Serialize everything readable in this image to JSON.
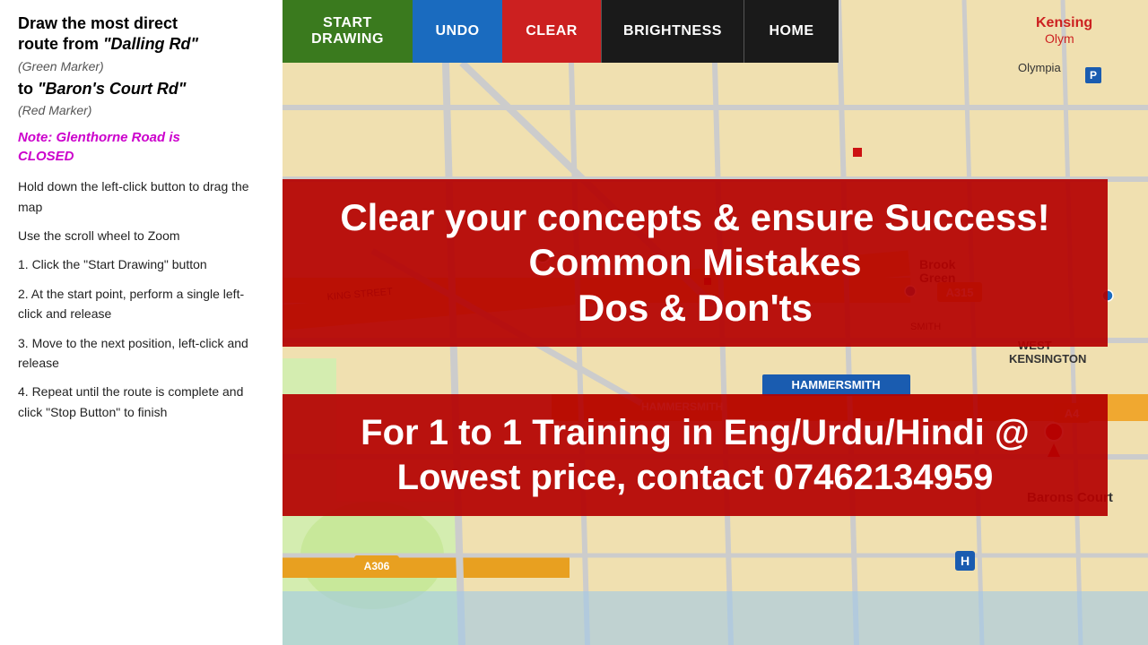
{
  "left_panel": {
    "title_line1": "Draw the most direct",
    "title_line2": "route from ",
    "from_location": "\"Dalling Rd\"",
    "from_marker": "(Green Marker)",
    "to_label": "to ",
    "to_location": "\"Baron's Court Rd\"",
    "to_marker": "(Red Marker)",
    "note_label": "Note: Glenthorne Road is",
    "note_closed": "CLOSED",
    "instruction1": "Hold down the left-click button to drag the map",
    "instruction2": "Use the scroll wheel to Zoom",
    "instruction3": "1. Click the \"Start Drawing\" button",
    "instruction4": "2. At the start point, perform a single left-click and release",
    "instruction5": "3. Move to the next position, left-click and release",
    "instruction6": "4. Repeat until the route is complete and click \"Stop Button\" to finish"
  },
  "toolbar": {
    "start_label_line1": "START",
    "start_label_line2": "DRAWING",
    "undo_label": "UNDO",
    "clear_label": "CLEAR",
    "brightness_label": "BRIGHTNESS",
    "home_label": "HOME"
  },
  "banner_top": {
    "line1": "Clear your concepts & ensure Success!",
    "line2": "Common Mistakes",
    "line3": "Dos & Don'ts"
  },
  "banner_bottom": {
    "line1": "For 1 to 1 Training in Eng/Urdu/Hindi @",
    "line2": "Lowest price, contact 07462134959"
  }
}
